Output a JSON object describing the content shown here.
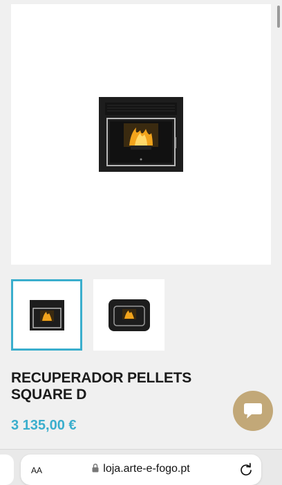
{
  "product": {
    "title": "RECUPERADOR PELLETS SQUARE D",
    "price": "3 135,00 €",
    "images": {
      "main": "pellet-stove-front-image",
      "thumbnails": [
        "pellet-stove-front-thumbnail",
        "pellet-stove-rounded-thumbnail"
      ],
      "selected_index": 0
    }
  },
  "chat": {
    "icon": "chat-bubble-icon"
  },
  "browser": {
    "text_size_label": "AA",
    "url": "loja.arte-e-fogo.pt",
    "lock_icon": "lock-icon",
    "reload_icon": "reload-icon"
  },
  "colors": {
    "accent": "#3aaecd",
    "chat_button": "#c2a878",
    "title": "#1b1b1b"
  }
}
